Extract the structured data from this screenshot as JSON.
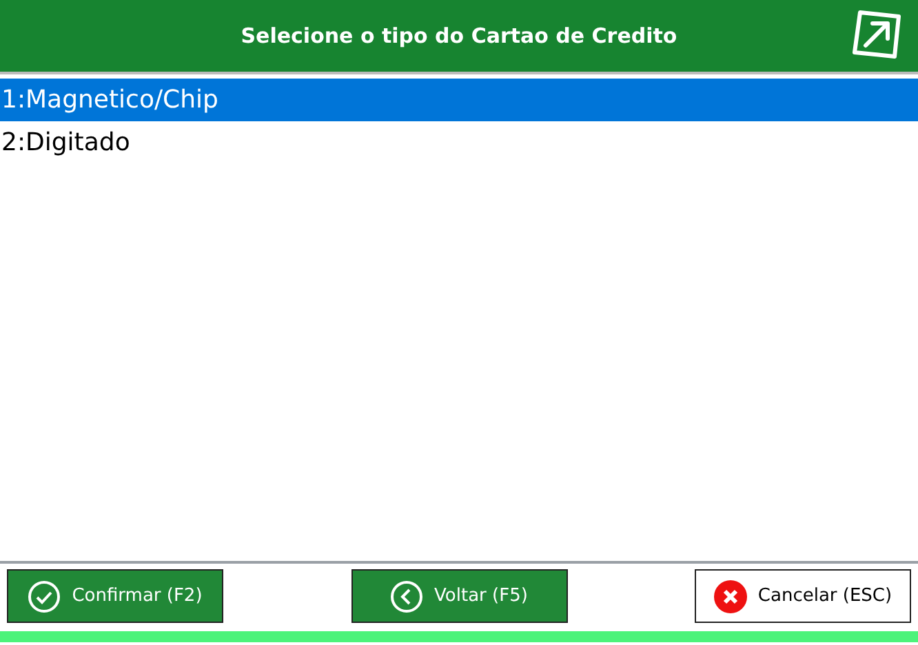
{
  "header": {
    "title": "Selecione o tipo do Cartao de Credito"
  },
  "options": [
    {
      "label": "1:Magnetico/Chip",
      "selected": true
    },
    {
      "label": "2:Digitado",
      "selected": false
    }
  ],
  "buttons": [
    {
      "label": "Confirmar (F2)",
      "kind": "confirm"
    },
    {
      "label": "Voltar (F5)",
      "kind": "back"
    },
    {
      "label": "Cancelar (ESC)",
      "kind": "cancel"
    }
  ]
}
